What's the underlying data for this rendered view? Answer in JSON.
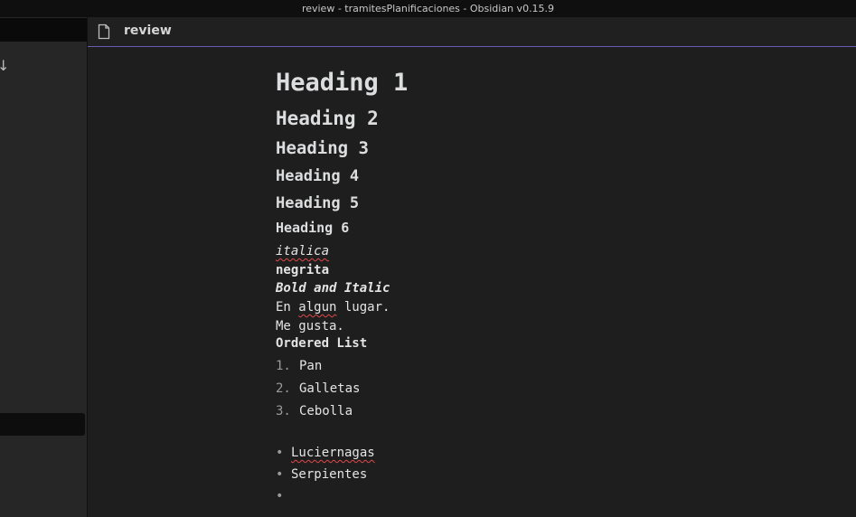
{
  "window": {
    "title": "review - tramitesPlanificaciones - Obsidian v0.15.9"
  },
  "sidebar": {
    "sort_icon_glyph": "↓"
  },
  "tab": {
    "icon": "file-icon",
    "title": "review"
  },
  "document": {
    "headings": [
      "Heading 1",
      "Heading 2",
      "Heading 3",
      "Heading 4",
      "Heading 5",
      "Heading 6"
    ],
    "italic": "italica",
    "bold": "negrita",
    "bold_italic": "Bold and Italic",
    "paragraph1_prefix": "En ",
    "paragraph1_misspelled": "algun",
    "paragraph1_suffix": " lugar.",
    "paragraph2": "Me gusta.",
    "ordered_list_label": "Ordered List",
    "ordered_list": [
      {
        "number": "1.",
        "text": "Pan"
      },
      {
        "number": "2.",
        "text": "Galletas"
      },
      {
        "number": "3.",
        "text": "Cebolla"
      }
    ],
    "bullet_glyph": "•",
    "bullet_list": [
      {
        "text": "Luciernagas",
        "misspelled": true
      },
      {
        "text": "Serpientes",
        "misspelled": false
      },
      {
        "text": "",
        "misspelled": false
      }
    ]
  },
  "colors": {
    "accent": "#6a5bb0",
    "spellcheck": "#e04848",
    "background": "#1e1e1e"
  }
}
